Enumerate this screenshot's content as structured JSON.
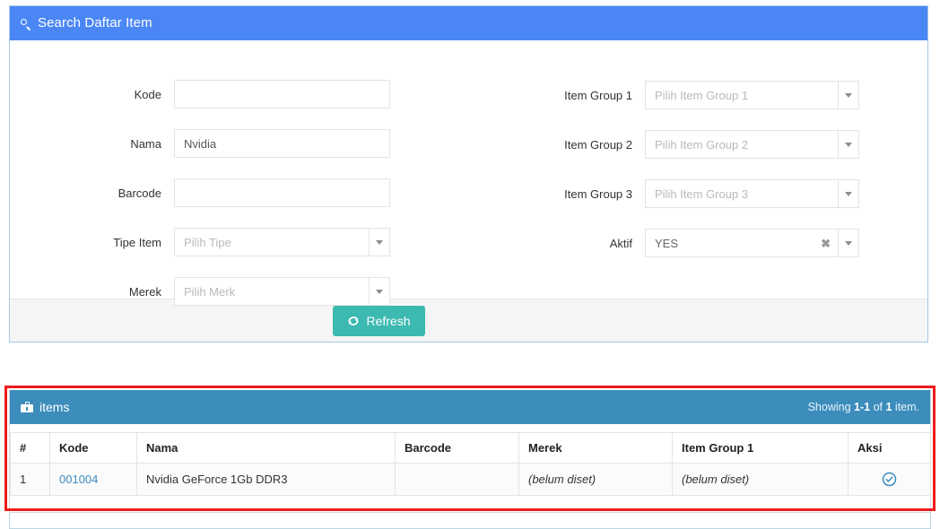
{
  "search_panel": {
    "icon": "search-icon",
    "title": "Search Daftar Item",
    "fields": {
      "kode": {
        "label": "Kode",
        "value": "",
        "placeholder": ""
      },
      "nama": {
        "label": "Nama",
        "value": "Nvidia",
        "placeholder": ""
      },
      "barcode": {
        "label": "Barcode",
        "value": "",
        "placeholder": ""
      },
      "tipe_item": {
        "label": "Tipe Item",
        "placeholder": "Pilih Tipe",
        "value": ""
      },
      "merek": {
        "label": "Merek",
        "placeholder": "Pilih Merk",
        "value": ""
      },
      "item_group_1": {
        "label": "Item Group 1",
        "placeholder": "Pilih Item Group 1",
        "value": ""
      },
      "item_group_2": {
        "label": "Item Group 2",
        "placeholder": "Pilih Item Group 2",
        "value": ""
      },
      "item_group_3": {
        "label": "Item Group 3",
        "placeholder": "Pilih Item Group 3",
        "value": ""
      },
      "aktif": {
        "label": "Aktif",
        "placeholder": "",
        "value": "YES",
        "clear": "✖"
      }
    },
    "refresh_button": {
      "label": "Refresh",
      "icon": "refresh-icon",
      "color": "#3cb9b0"
    }
  },
  "items_panel": {
    "icon": "briefcase-icon",
    "title": "items",
    "showing": {
      "prefix": "Showing ",
      "range": "1-1",
      "middle": " of ",
      "total": "1",
      "suffix": " item."
    },
    "header_color": "#3c8dbc",
    "columns": [
      "#",
      "Kode",
      "Nama",
      "Barcode",
      "Merek",
      "Item Group 1",
      "Aksi"
    ],
    "rows": [
      {
        "num": "1",
        "kode": "001004",
        "nama": "Nvidia GeForce 1Gb DDR3",
        "barcode": "",
        "merek": "(belum diset)",
        "item_group_1": "(belum diset)",
        "aksi_icon": "check-circle-icon"
      }
    ]
  },
  "highlight": {
    "color": "#ee1b1b"
  }
}
